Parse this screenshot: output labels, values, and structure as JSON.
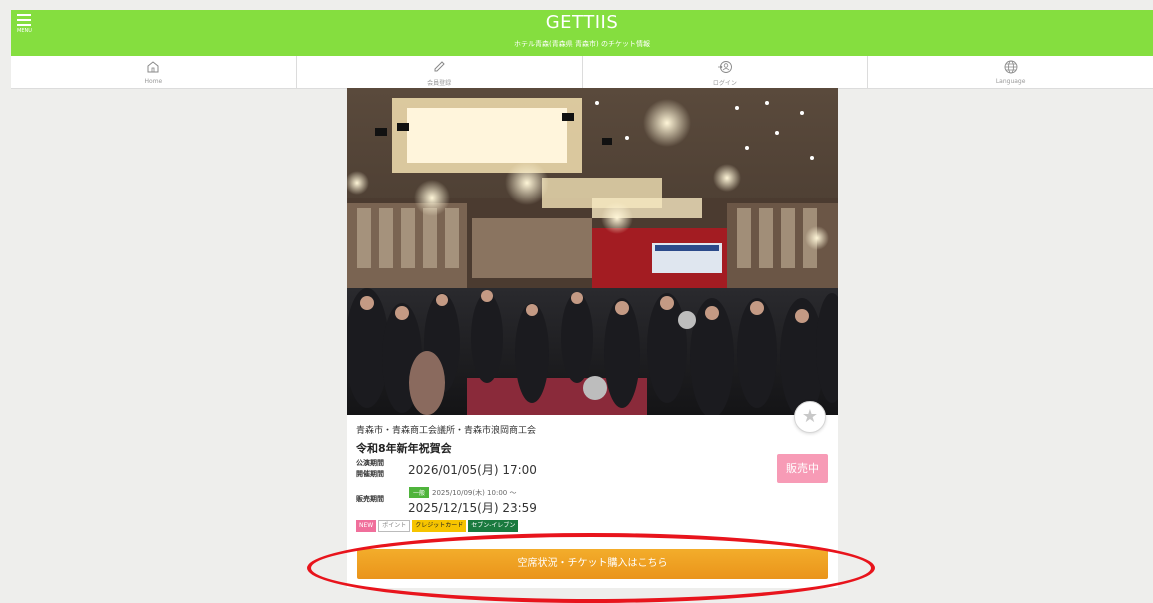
{
  "header": {
    "menu_label": "MENU",
    "title": "GETTIIS",
    "subtitle": "ホテル青森(青森県 青森市) のチケット情報"
  },
  "nav": {
    "home": "Home",
    "register": "会員登録",
    "login": "ログイン",
    "language": "Language"
  },
  "event": {
    "organizer": "青森市・青森商工会議所・青森市浪岡商工会",
    "title": "令和8年新年祝賀会",
    "perf_label_1": "公演期間",
    "perf_label_2": "開催期間",
    "perf_date": "2026/01/05(月) 17:00",
    "status": "販売中",
    "sale_label": "販売期間",
    "sale_type": "一般",
    "sale_start": "2025/10/09(木) 10:00 ～",
    "sale_end": "2025/12/15(月) 23:59",
    "tags": {
      "new": "NEW",
      "point": "ポイント",
      "credit": "クレジットカード",
      "seven": "セブン-イレブン"
    },
    "buy_button": "空席状況・チケット購入はこちら"
  },
  "colors": {
    "header_green": "#85de3f",
    "status_pink": "#f79bb6",
    "buy_orange": "#ea941b",
    "highlight_red": "#e8141c"
  }
}
